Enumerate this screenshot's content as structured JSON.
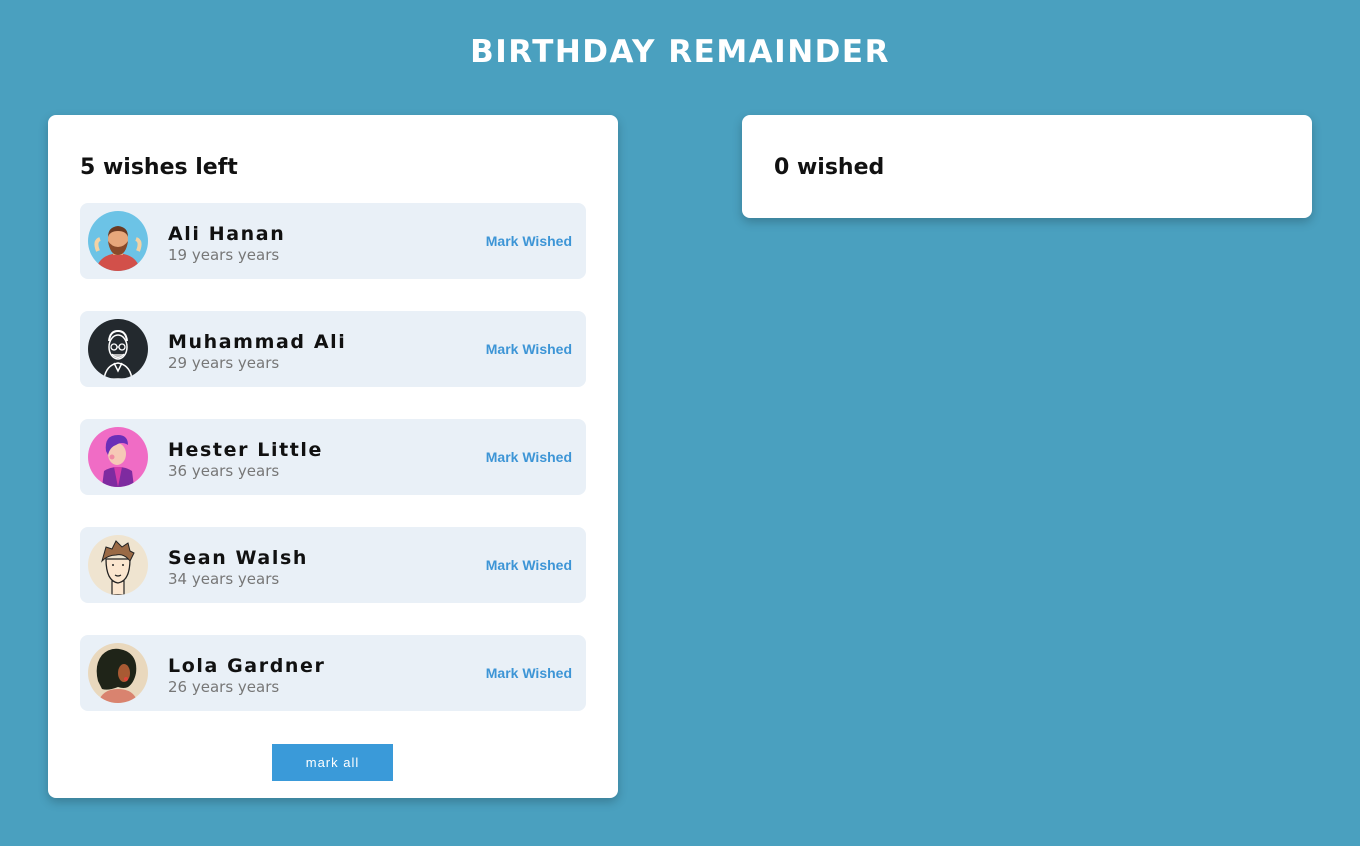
{
  "app": {
    "title": "BIRTHDAY REMAINDER"
  },
  "pending": {
    "heading": "5 wishes left",
    "people": [
      {
        "name": "Ali Hanan",
        "age": "19 years years",
        "action": "Mark Wished",
        "avatar": "bearded-man-avatar"
      },
      {
        "name": "Muhammad Ali",
        "age": "29 years years",
        "action": "Mark Wished",
        "avatar": "glasses-man-avatar"
      },
      {
        "name": "Hester Little",
        "age": "36 years years",
        "action": "Mark Wished",
        "avatar": "purple-hair-avatar"
      },
      {
        "name": "Sean Walsh",
        "age": "34 years years",
        "action": "Mark Wished",
        "avatar": "brown-hair-man-avatar"
      },
      {
        "name": "Lola Gardner",
        "age": "26 years years",
        "action": "Mark Wished",
        "avatar": "curly-hair-woman-avatar"
      }
    ],
    "mark_all_label": "mark all"
  },
  "wished": {
    "heading": "0 wished"
  },
  "colors": {
    "background": "#4aa0bf",
    "accent": "#3a9ad9",
    "card": "#e9f0f7"
  }
}
